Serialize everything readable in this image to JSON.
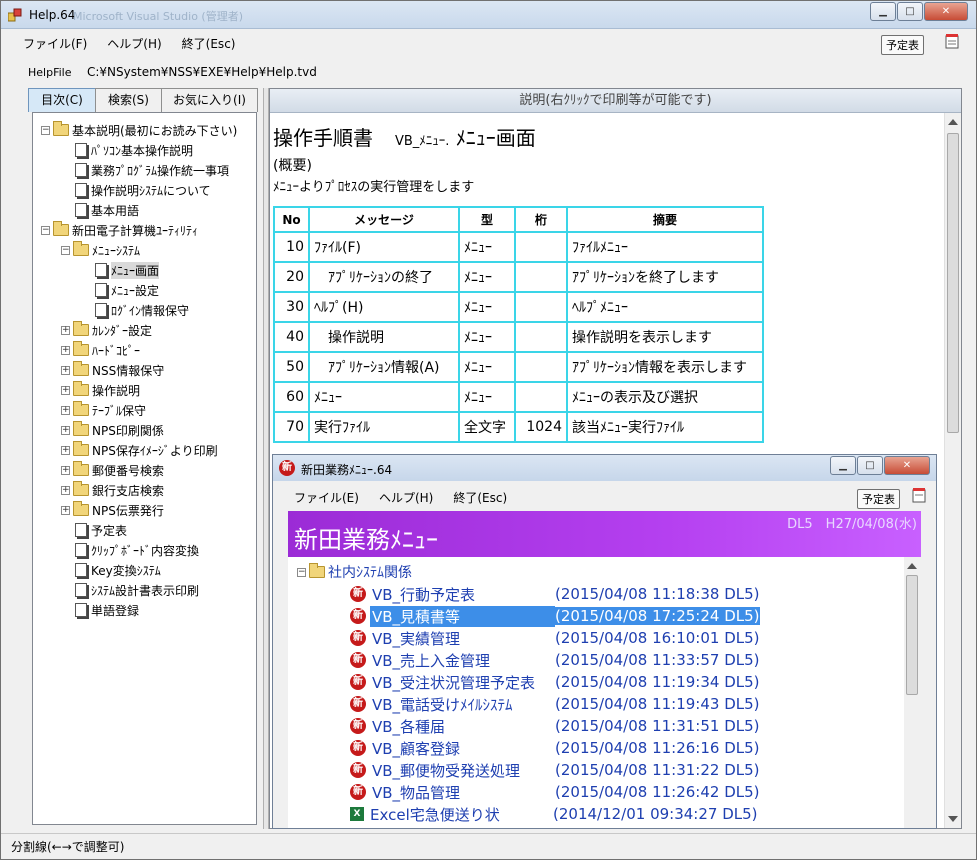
{
  "window": {
    "title": "Help.64",
    "ghost_title": "Microsoft Visual Studio (管理者)"
  },
  "menu": {
    "file": "ファイル(F)",
    "help": "ヘルプ(H)",
    "exit": "終了(Esc)",
    "schedule": "予定表"
  },
  "helpfile": {
    "label": "HelpFile",
    "path": "C:¥NSystem¥NSS¥EXE¥Help¥Help.tvd"
  },
  "tabs": [
    "目次(C)",
    "検索(S)",
    "お気に入り(I)"
  ],
  "tree": [
    {
      "label": "基本説明(最初にお読み下さい)",
      "icon": "folder-open-icon",
      "exp": "−"
    },
    {
      "label": "ﾊﾟｿｺﾝ基本操作説明",
      "icon": "document-icon"
    },
    {
      "label": "業務ﾌﾟﾛｸﾞﾗﾑ操作統一事項",
      "icon": "document-icon"
    },
    {
      "label": "操作説明ｼｽﾃﾑについて",
      "icon": "document-icon"
    },
    {
      "label": "基本用語",
      "icon": "document-icon"
    },
    {
      "label": "新田電子計算機ﾕｰﾃｨﾘﾃｨ",
      "icon": "folder-open-icon",
      "exp": "−"
    },
    {
      "label": "ﾒﾆｭｰｼｽﾃﾑ",
      "icon": "folder-open-icon",
      "exp": "−"
    },
    {
      "label": "ﾒﾆｭｰ画面",
      "icon": "document-icon",
      "selected": true
    },
    {
      "label": "ﾒﾆｭｰ設定",
      "icon": "document-icon"
    },
    {
      "label": "ﾛｸﾞｲﾝ情報保守",
      "icon": "document-icon"
    },
    {
      "label": "ｶﾚﾝﾀﾞｰ設定",
      "icon": "folder-icon",
      "exp": "+"
    },
    {
      "label": "ﾊｰﾄﾞｺﾋﾟｰ",
      "icon": "folder-icon",
      "exp": "+"
    },
    {
      "label": "NSS情報保守",
      "icon": "folder-icon",
      "exp": "+"
    },
    {
      "label": "操作説明",
      "icon": "folder-icon",
      "exp": "+"
    },
    {
      "label": "ﾃｰﾌﾞﾙ保守",
      "icon": "folder-icon",
      "exp": "+"
    },
    {
      "label": "NPS印刷関係",
      "icon": "folder-icon",
      "exp": "+"
    },
    {
      "label": "NPS保存ｲﾒｰｼﾞより印刷",
      "icon": "folder-icon",
      "exp": "+"
    },
    {
      "label": "郵便番号検索",
      "icon": "folder-icon",
      "exp": "+"
    },
    {
      "label": "銀行支店検索",
      "icon": "folder-icon",
      "exp": "+"
    },
    {
      "label": "NPS伝票発行",
      "icon": "folder-icon",
      "exp": "+"
    },
    {
      "label": "予定表",
      "icon": "document-icon"
    },
    {
      "label": "ｸﾘｯﾌﾟﾎﾞｰﾄﾞ内容変換",
      "icon": "document-icon"
    },
    {
      "label": "Key変換ｼｽﾃﾑ",
      "icon": "document-icon"
    },
    {
      "label": "ｼｽﾃﾑ設計書表示印刷",
      "icon": "document-icon"
    },
    {
      "label": "単語登録",
      "icon": "document-icon"
    }
  ],
  "content": {
    "header": "説明(右ｸﾘｯｸで印刷等が可能です)",
    "title_main": "操作手順書",
    "title_sub": "VB_ﾒﾆｭｰ.",
    "title_screen": "ﾒﾆｭｰ画面",
    "overview_label": "(概要)",
    "overview_text": "ﾒﾆｭｰよりﾌﾟﾛｾｽの実行管理をします"
  },
  "table": {
    "headers": [
      "No",
      "メッセージ",
      "型",
      "桁",
      "摘要"
    ],
    "rows": [
      [
        "10",
        "ﾌｧｲﾙ(F)",
        "ﾒﾆｭｰ",
        "",
        "ﾌｧｲﾙﾒﾆｭｰ"
      ],
      [
        "20",
        "　ｱﾌﾟﾘｹｰｼｮﾝの終了",
        "ﾒﾆｭｰ",
        "",
        "ｱﾌﾟﾘｹｰｼｮﾝを終了します"
      ],
      [
        "30",
        "ﾍﾙﾌﾟ(H)",
        "ﾒﾆｭｰ",
        "",
        "ﾍﾙﾌﾟﾒﾆｭｰ"
      ],
      [
        "40",
        "　操作説明",
        "ﾒﾆｭｰ",
        "",
        "操作説明を表示します"
      ],
      [
        "50",
        "　ｱﾌﾟﾘｹｰｼｮﾝ情報(A)",
        "ﾒﾆｭｰ",
        "",
        "ｱﾌﾟﾘｹｰｼｮﾝ情報を表示します"
      ],
      [
        "60",
        "ﾒﾆｭｰ",
        "ﾒﾆｭｰ",
        "",
        "ﾒﾆｭｰの表示及び選択"
      ],
      [
        "70",
        "実行ﾌｧｲﾙ",
        "全文字",
        "1024",
        "該当ﾒﾆｭｰ実行ﾌｧｲﾙ"
      ]
    ]
  },
  "inner": {
    "title": "新田業務ﾒﾆｭｰ.64",
    "menu_file": "ファイル(E)",
    "menu_help": "ヘルプ(H)",
    "menu_exit": "終了(Esc)",
    "schedule": "予定表",
    "banner_title": "新田業務ﾒﾆｭｰ",
    "banner_info": "DL5　H27/04/08(水)",
    "group": "社内ｼｽﾃﾑ関係",
    "items": [
      {
        "name": "VB_行動予定表",
        "ts": "(2015/04/08 11:18:38 DL5)"
      },
      {
        "name": "VB_見積書等",
        "ts": "(2015/04/08 17:25:24 DL5)",
        "selected": true
      },
      {
        "name": "VB_実績管理",
        "ts": "(2015/04/08 16:10:01 DL5)"
      },
      {
        "name": "VB_売上入金管理",
        "ts": "(2015/04/08 11:33:57 DL5)"
      },
      {
        "name": "VB_受注状況管理予定表",
        "ts": "(2015/04/08 11:19:34 DL5)"
      },
      {
        "name": "VB_電話受けﾒｲﾙｼｽﾃﾑ",
        "ts": "(2015/04/08 11:19:43 DL5)"
      },
      {
        "name": "VB_各種届",
        "ts": "(2015/04/08 11:31:51 DL5)"
      },
      {
        "name": "VB_顧客登録",
        "ts": "(2015/04/08 11:26:16 DL5)"
      },
      {
        "name": "VB_郵便物受発送処理",
        "ts": "(2015/04/08 11:31:22 DL5)"
      },
      {
        "name": "VB_物品管理",
        "ts": "(2015/04/08 11:26:42 DL5)"
      },
      {
        "name": "Excel宅急便送り状",
        "ts": "(2014/12/01 09:34:27 DL5)",
        "excel": true
      }
    ]
  },
  "status": "分割線(←→で調整可)",
  "colors": {
    "accent_cyan": "#3ad5e8",
    "banner_purple": "#a335e2",
    "link_blue": "#1e3fb0",
    "select_blue": "#3d8ee8"
  }
}
